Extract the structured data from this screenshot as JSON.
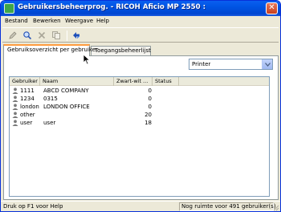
{
  "window": {
    "title": "Gebruikersbeheerprog. - RICOH Aficio MP 2550 :"
  },
  "menu": [
    "Bestand",
    "Bewerken",
    "Weergave",
    "Help"
  ],
  "toolbar": {
    "buttons": [
      {
        "icon": "edit-icon"
      },
      {
        "icon": "search-icon"
      },
      {
        "icon": "delete-icon"
      },
      {
        "icon": "copy-icon"
      },
      {
        "icon": "refresh-icon"
      }
    ]
  },
  "tabs": [
    {
      "label": "Gebruiksoverzicht per gebruiker",
      "active": true
    },
    {
      "label": "Toegangsbeheerlijst",
      "active": false
    }
  ],
  "filter": {
    "selected": "Printer"
  },
  "list": {
    "columns": [
      "Gebruiker",
      "Naam",
      "Zwart-wit ...",
      "Status"
    ],
    "rows": [
      {
        "user": "1111",
        "name": "ABCD COMPANY",
        "bw": "0",
        "status": ""
      },
      {
        "user": "1234",
        "name": "0315",
        "bw": "0",
        "status": ""
      },
      {
        "user": "london",
        "name": "LONDON OFFICE",
        "bw": "0",
        "status": ""
      },
      {
        "user": "other",
        "name": "",
        "bw": "20",
        "status": ""
      },
      {
        "user": "user",
        "name": "user",
        "bw": "18",
        "status": ""
      }
    ]
  },
  "status": {
    "left": "Druk op F1 voor Help",
    "right": "Nog ruimte voor 491 gebruiker(s)"
  },
  "colors": {
    "titlebar": "#0054e3",
    "active_tab_accent": "#ff9c3f",
    "chrome": "#ece9d8"
  }
}
